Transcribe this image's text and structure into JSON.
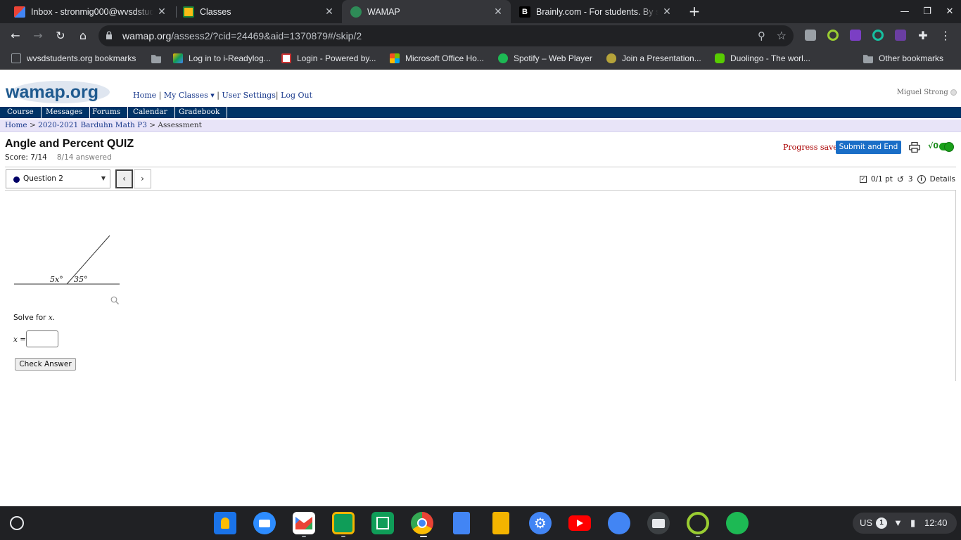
{
  "browser": {
    "tabs": [
      {
        "title": "Inbox - stronmig000@wvsdstud",
        "favicon": "gmail-icon"
      },
      {
        "title": "Classes",
        "favicon": "google-classroom-icon"
      },
      {
        "title": "WAMAP",
        "favicon": "wamap-icon",
        "active": true
      },
      {
        "title": "Brainly.com - For students. By st",
        "favicon": "brainly-icon"
      }
    ],
    "url_host": "wamap.org",
    "url_path": "/assess2/?cid=24469&aid=1370879#/skip/2"
  },
  "bookmarks": [
    {
      "label": "wvsdstudents.org bookmarks",
      "icon": "apps-icon"
    },
    {
      "label": "",
      "icon": "folder-icon"
    },
    {
      "label": "Log in to i-Readylog...",
      "icon": "iready-icon"
    },
    {
      "label": "Login - Powered by...",
      "icon": "login-icon"
    },
    {
      "label": "Microsoft Office Ho...",
      "icon": "microsoft-icon"
    },
    {
      "label": "Spotify – Web Player",
      "icon": "spotify-icon"
    },
    {
      "label": "Join a Presentation...",
      "icon": "peardeck-icon"
    },
    {
      "label": "Duolingo - The worl...",
      "icon": "duolingo-icon"
    },
    {
      "label": "Other bookmarks",
      "icon": "folder-icon"
    }
  ],
  "site": {
    "logo_text": "wamap.org",
    "links": {
      "home": "Home",
      "my_classes": "My Classes ▾",
      "user_settings": "User Settings",
      "logout": "Log Out"
    },
    "username": "Miguel Strong",
    "nav": [
      "Course",
      "Messages",
      "Forums",
      "Calendar",
      "Gradebook"
    ],
    "breadcrumb": {
      "home": "Home",
      "course": "2020-2021 Barduhn Math P3",
      "current": "Assessment"
    }
  },
  "assessment": {
    "title": "Angle and Percent QUIZ",
    "score": "Score: 7/14",
    "answered": "8/14 answered",
    "progress_saved": "Progress saved",
    "submit_label": "Submit and End",
    "math_toggle": "√0",
    "question_select": "Question 2",
    "points": "0/1 pt",
    "retries": "3",
    "details": "Details"
  },
  "question": {
    "angle_left": "5x°",
    "angle_right": "35°",
    "prompt": "Solve for",
    "variable": "x",
    "answer_label_var": "x",
    "answer_label_eq": " =",
    "answer_value": "",
    "check_label": "Check Answer"
  },
  "shelf": {
    "apps": [
      "keep-icon",
      "zoom-icon",
      "gmail-icon",
      "classroom-icon",
      "sheets-icon",
      "chrome-icon",
      "docs-icon",
      "slides-icon",
      "settings-icon",
      "youtube-icon",
      "files-icon",
      "camera-icon",
      "iready-icon",
      "spotify-icon"
    ],
    "locale": "US",
    "notifications": "1",
    "time": "12:40"
  }
}
